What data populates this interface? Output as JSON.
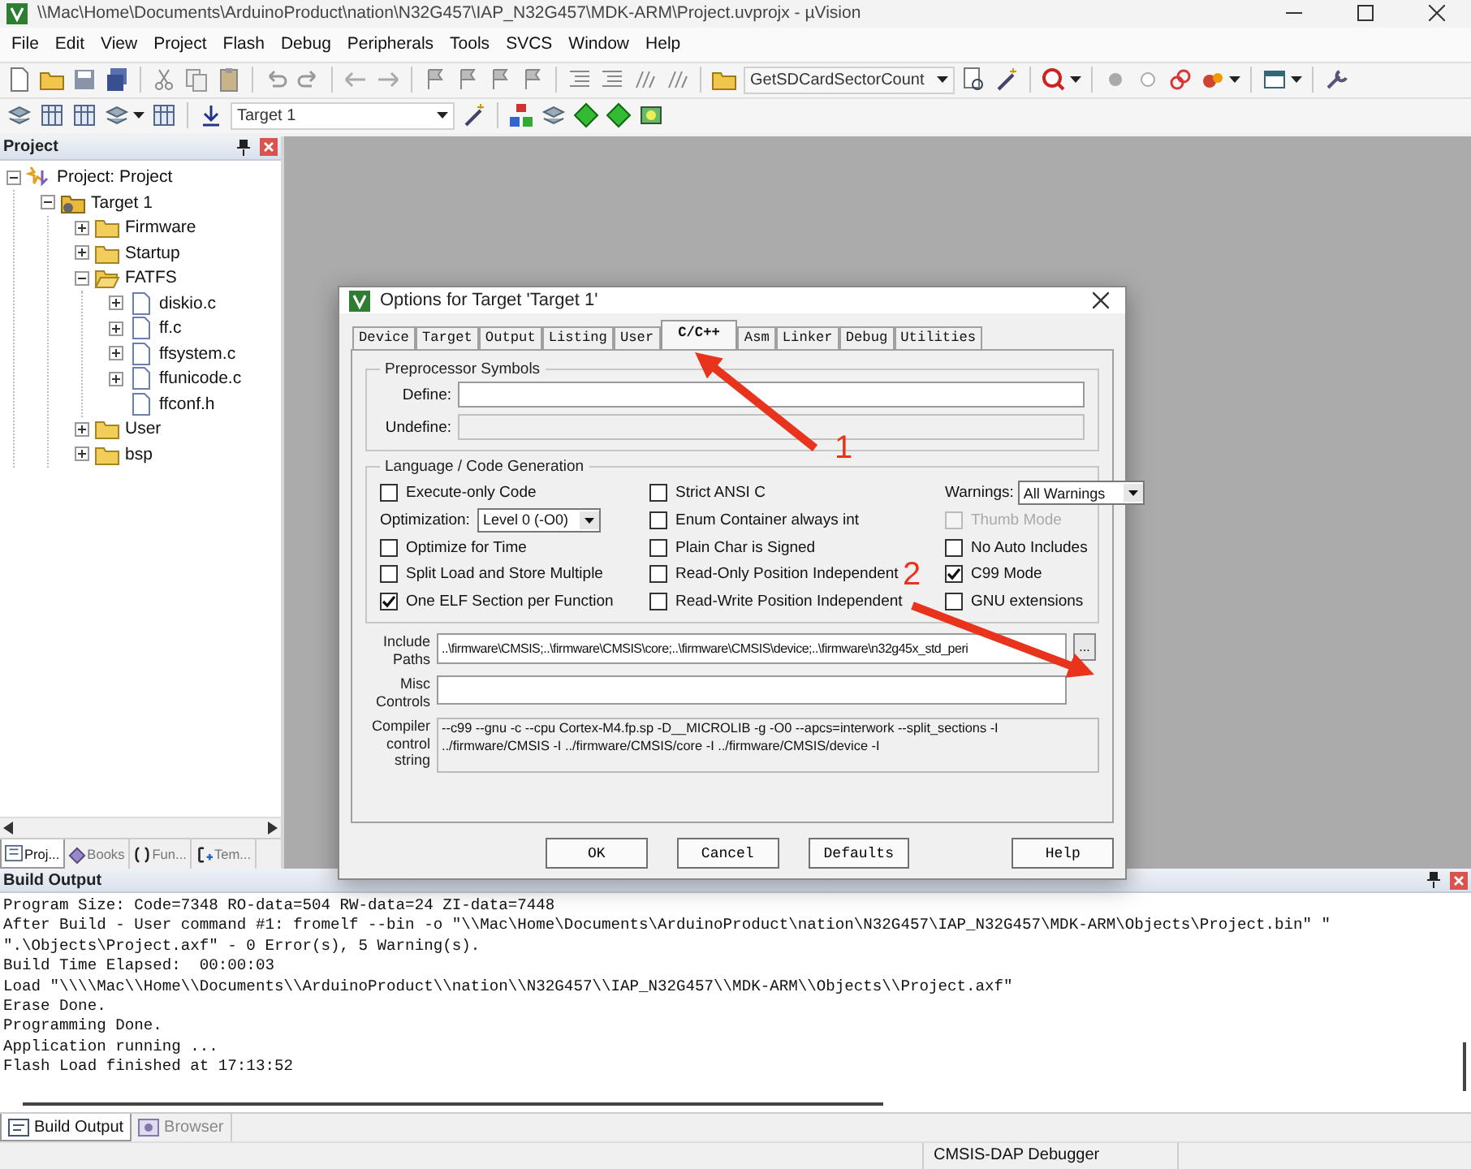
{
  "window": {
    "title": "\\\\Mac\\Home\\Documents\\ArduinoProduct\\nation\\N32G457\\IAP_N32G457\\MDK-ARM\\Project.uvprojx - µVision"
  },
  "menu": [
    "File",
    "Edit",
    "View",
    "Project",
    "Flash",
    "Debug",
    "Peripherals",
    "Tools",
    "SVCS",
    "Window",
    "Help"
  ],
  "toolbar": {
    "function_combo": "GetSDCardSectorCount",
    "target_select": "Target 1"
  },
  "project_panel": {
    "title": "Project",
    "tree": [
      {
        "kind": "project",
        "label": "Project: Project",
        "expanded": true,
        "children": [
          {
            "kind": "target",
            "label": "Target 1",
            "expanded": true,
            "children": [
              {
                "kind": "group",
                "label": "Firmware",
                "expanded": false
              },
              {
                "kind": "group",
                "label": "Startup",
                "expanded": false
              },
              {
                "kind": "group",
                "label": "FATFS",
                "expanded": true,
                "children": [
                  {
                    "kind": "file",
                    "label": "diskio.c",
                    "expanded": false
                  },
                  {
                    "kind": "file",
                    "label": "ff.c",
                    "expanded": false
                  },
                  {
                    "kind": "file",
                    "label": "ffsystem.c",
                    "expanded": false
                  },
                  {
                    "kind": "file",
                    "label": "ffunicode.c",
                    "expanded": false
                  },
                  {
                    "kind": "file",
                    "label": "ffconf.h"
                  }
                ]
              },
              {
                "kind": "group",
                "label": "User",
                "expanded": false
              },
              {
                "kind": "group",
                "label": "bsp",
                "expanded": false
              }
            ]
          }
        ]
      }
    ],
    "tabs": [
      {
        "label": "Proj...",
        "selected": true
      },
      {
        "label": "Books",
        "selected": false
      },
      {
        "label": "Fun...",
        "selected": false
      },
      {
        "label": "Tem...",
        "selected": false
      }
    ]
  },
  "dialog": {
    "title": "Options for Target 'Target 1'",
    "tabs": [
      {
        "label": "Device",
        "selected": false
      },
      {
        "label": "Target",
        "selected": false
      },
      {
        "label": "Output",
        "selected": false
      },
      {
        "label": "Listing",
        "selected": false
      },
      {
        "label": "User",
        "selected": false
      },
      {
        "label": "C/C++",
        "selected": true
      },
      {
        "label": "Asm",
        "selected": false
      },
      {
        "label": "Linker",
        "selected": false
      },
      {
        "label": "Debug",
        "selected": false
      },
      {
        "label": "Utilities",
        "selected": false
      }
    ],
    "preprocessor": {
      "title": "Preprocessor Symbols",
      "fields": [
        {
          "label": "Define:",
          "disabled": false
        },
        {
          "label": "Undefine:",
          "disabled": true
        }
      ]
    },
    "codegen": {
      "title": "Language / Code Generation",
      "columns": [
        [
          {
            "kind": "checkbox",
            "label": "Execute-only Code",
            "checked": false,
            "disabled": false
          },
          {
            "kind": "select",
            "label": "Optimization:",
            "value": "Level 0 (-O0)"
          },
          {
            "kind": "checkbox",
            "label": "Optimize for Time",
            "checked": false,
            "disabled": false
          },
          {
            "kind": "checkbox",
            "label": "Split Load and Store Multiple",
            "checked": false,
            "disabled": false
          },
          {
            "kind": "checkbox",
            "label": "One ELF Section per Function",
            "checked": true,
            "disabled": false
          }
        ],
        [
          {
            "kind": "checkbox",
            "label": "Strict ANSI C",
            "checked": false,
            "disabled": false
          },
          {
            "kind": "checkbox",
            "label": "Enum Container always int",
            "checked": false,
            "disabled": false
          },
          {
            "kind": "checkbox",
            "label": "Plain Char is Signed",
            "checked": false,
            "disabled": false
          },
          {
            "kind": "checkbox",
            "label": "Read-Only Position Independent",
            "checked": false,
            "disabled": false
          },
          {
            "kind": "checkbox",
            "label": "Read-Write Position Independent",
            "checked": false,
            "disabled": false
          }
        ],
        [
          {
            "kind": "select",
            "label": "Warnings:",
            "value": "All Warnings"
          },
          {
            "kind": "checkbox",
            "label": "Thumb Mode",
            "checked": false,
            "disabled": true
          },
          {
            "kind": "checkbox",
            "label": "No Auto Includes",
            "checked": false,
            "disabled": false
          },
          {
            "kind": "checkbox",
            "label": "C99 Mode",
            "checked": true,
            "disabled": false
          },
          {
            "kind": "checkbox",
            "label": "GNU extensions",
            "checked": false,
            "disabled": false
          }
        ]
      ]
    },
    "include_paths": {
      "label": "Include Paths",
      "value": "..\\firmware\\CMSIS;..\\firmware\\CMSIS\\core;..\\firmware\\CMSIS\\device;..\\firmware\\n32g45x_std_peri",
      "button": "..."
    },
    "misc_controls": {
      "label": "Misc Controls"
    },
    "compiler_string": {
      "label": "Compiler control string",
      "lines": [
        "--c99 --gnu -c --cpu Cortex-M4.fp.sp -D__MICROLIB -g -O0 --apcs=interwork --split_sections -I",
        "../firmware/CMSIS -I ../firmware/CMSIS/core -I ../firmware/CMSIS/device -I"
      ]
    },
    "buttons": [
      "OK",
      "Cancel",
      "Defaults",
      "Help"
    ]
  },
  "build_output": {
    "title": "Build Output",
    "lines": [
      "Program Size: Code=7348 RO-data=504 RW-data=24 ZI-data=7448",
      "After Build - User command #1: fromelf --bin -o \"\\\\Mac\\Home\\Documents\\ArduinoProduct\\nation\\N32G457\\IAP_N32G457\\MDK-ARM\\Objects\\Project.bin\" \"",
      "\".\\Objects\\Project.axf\" - 0 Error(s), 5 Warning(s).",
      "Build Time Elapsed:  00:00:03",
      "Load \"\\\\\\\\Mac\\\\Home\\\\Documents\\\\ArduinoProduct\\\\nation\\\\N32G457\\\\IAP_N32G457\\\\MDK-ARM\\\\Objects\\\\Project.axf\"",
      "Erase Done.",
      "Programming Done.",
      "Application running ...",
      "Flash Load finished at 17:13:52"
    ],
    "tabs": [
      {
        "label": "Build Output",
        "selected": true
      },
      {
        "label": "Browser",
        "selected": false
      }
    ]
  },
  "status_bar": {
    "debugger": "CMSIS-DAP Debugger"
  },
  "annotations": [
    {
      "label": "1"
    },
    {
      "label": "2"
    }
  ]
}
